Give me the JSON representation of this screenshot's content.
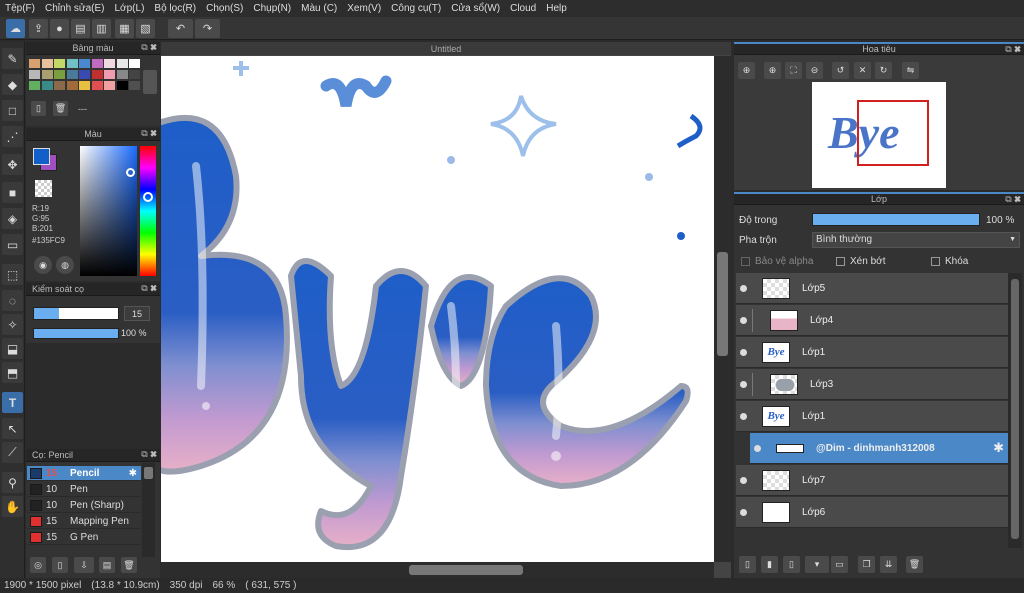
{
  "menu": [
    "Tệp(F)",
    "Chỉnh sửa(E)",
    "Lớp(L)",
    "Bộ lọc(R)",
    "Chọn(S)",
    "Chụp(N)",
    "Màu (C)",
    "Xem(V)",
    "Công cụ(T)",
    "Cửa sổ(W)",
    "Cloud",
    "Help"
  ],
  "palette": {
    "title": "Bảng màu",
    "blank_label": "---",
    "colors": [
      "#d9a070",
      "#e8c09c",
      "#c4d86a",
      "#70c0c4",
      "#4a88d0",
      "#c06ac0",
      "#f0d8e0",
      "#e8e8e8",
      "#ffffff",
      "#b8b8b8",
      "#a8a070",
      "#7a9f40",
      "#4a7a9a",
      "#3a4ab0",
      "#c03030",
      "#f09cb0",
      "#888888",
      "#444444",
      "#60b060",
      "#3a8a8a",
      "#8a6a4a",
      "#a06a3a",
      "#e8c040",
      "#e05050",
      "#f0a0a0",
      "#000000",
      "#505050"
    ]
  },
  "color_panel": {
    "title": "Màu",
    "r": "R:19",
    "g": "G:95",
    "b": "B:201",
    "hex": "#135FC9",
    "main_color": "#135fc9",
    "sub_color": "#a04fc0"
  },
  "brush_control": {
    "title": "Kiểm soát cọ",
    "size": "15",
    "opacity": "100 %"
  },
  "brush_list": {
    "title": "Cọ: Pencil",
    "items": [
      {
        "size": "15",
        "name": "Pencil",
        "color": "#1a3a6a",
        "selected": true
      },
      {
        "size": "10",
        "name": "Pen",
        "color": "#222222",
        "selected": false
      },
      {
        "size": "10",
        "name": "Pen (Sharp)",
        "color": "#222222",
        "selected": false
      },
      {
        "size": "15",
        "name": "Mapping Pen",
        "color": "#e03030",
        "selected": false
      },
      {
        "size": "15",
        "name": "G Pen",
        "color": "#e03030",
        "selected": false
      }
    ]
  },
  "canvas": {
    "tab_title": "Untitled",
    "art_text": "Bye"
  },
  "navigator": {
    "title": "Hoa tiêu"
  },
  "layers_panel": {
    "title": "Lớp",
    "opacity_label": "Độ trong",
    "opacity_value": "100 %",
    "blend_label": "Pha trộn",
    "blend_value": "Bình thường",
    "protect_alpha": "Bảo vệ alpha",
    "clipping": "Xén bớt",
    "lock": "Khóa",
    "layers": [
      {
        "name": "Lớp5",
        "indent": false,
        "selected": false,
        "thumb": "empty"
      },
      {
        "name": "Lớp4",
        "indent": true,
        "selected": false,
        "thumb": "pink"
      },
      {
        "name": "Lớp1",
        "indent": false,
        "selected": false,
        "thumb": "bye"
      },
      {
        "name": "Lớp3",
        "indent": true,
        "selected": false,
        "thumb": "gray"
      },
      {
        "name": "Lớp1",
        "indent": false,
        "selected": false,
        "thumb": "bye"
      },
      {
        "name": "@Dim - dinhmanh312008",
        "indent": false,
        "selected": true,
        "thumb": "strip"
      },
      {
        "name": "Lớp7",
        "indent": false,
        "selected": false,
        "thumb": "empty"
      },
      {
        "name": "Lớp6",
        "indent": false,
        "selected": false,
        "thumb": "white"
      }
    ]
  },
  "status": {
    "size": "1900 * 1500 pixel",
    "physical": "(13.8 * 10.9cm)",
    "dpi": "350 dpi",
    "zoom": "66 %",
    "cursor": "( 631, 575 )"
  }
}
